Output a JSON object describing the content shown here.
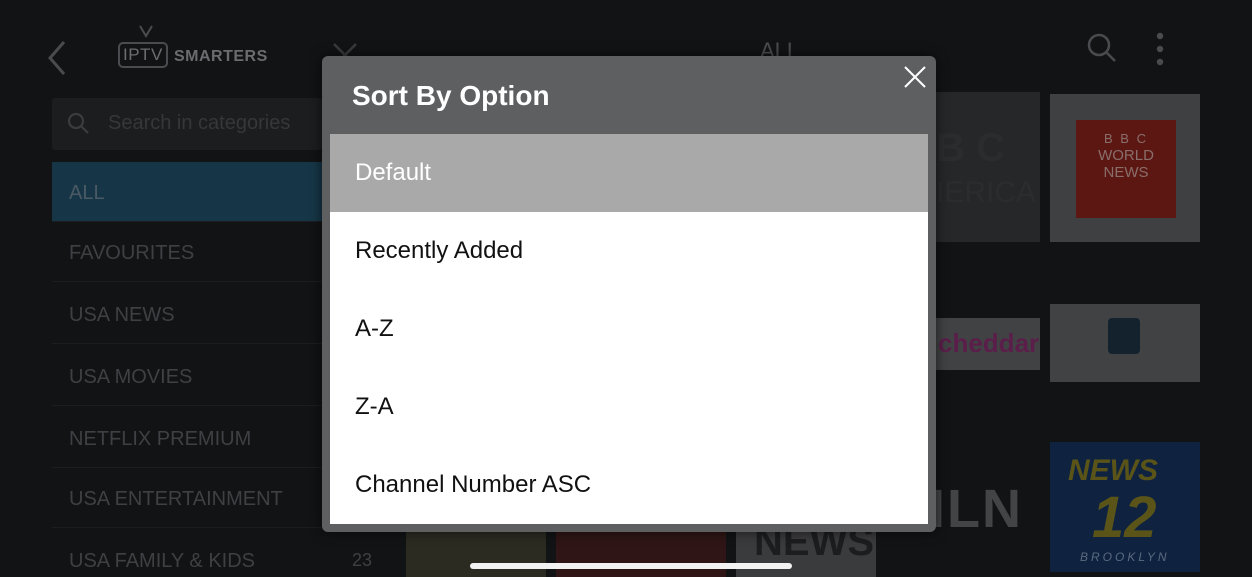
{
  "header": {
    "logo_iptv": "IPTV",
    "logo_brand": "SMARTERS",
    "title": "ALL"
  },
  "sidebar": {
    "search_placeholder": "Search in categories",
    "categories": [
      {
        "label": "ALL",
        "active": true
      },
      {
        "label": "FAVOURITES"
      },
      {
        "label": "USA NEWS"
      },
      {
        "label": "USA MOVIES"
      },
      {
        "label": "NETFLIX PREMIUM"
      },
      {
        "label": "USA ENTERTAINMENT"
      },
      {
        "label": "USA FAMILY & KIDS"
      }
    ],
    "last_count": "23"
  },
  "channels": {
    "bbc_america_line1": "B C",
    "bbc_america_line2": "IERICA",
    "bbc_world_blocks": "B B C",
    "bbc_world_line1": "WORLD",
    "bbc_world_line2": "NEWS",
    "cheddar": "cheddar",
    "hln": "HLN",
    "news": "NEWS",
    "news12_top": "NEWS",
    "news12_num": "12",
    "news12_bottom": "BROOKLYN"
  },
  "modal": {
    "title": "Sort By Option",
    "options": [
      {
        "label": "Default",
        "selected": true
      },
      {
        "label": "Recently Added"
      },
      {
        "label": "A-Z"
      },
      {
        "label": "Z-A"
      },
      {
        "label": "Channel Number ASC"
      }
    ]
  },
  "colors": {
    "modal_header": "#5e5f61",
    "selected_option": "#a9a9a9",
    "active_category": "#163647"
  }
}
